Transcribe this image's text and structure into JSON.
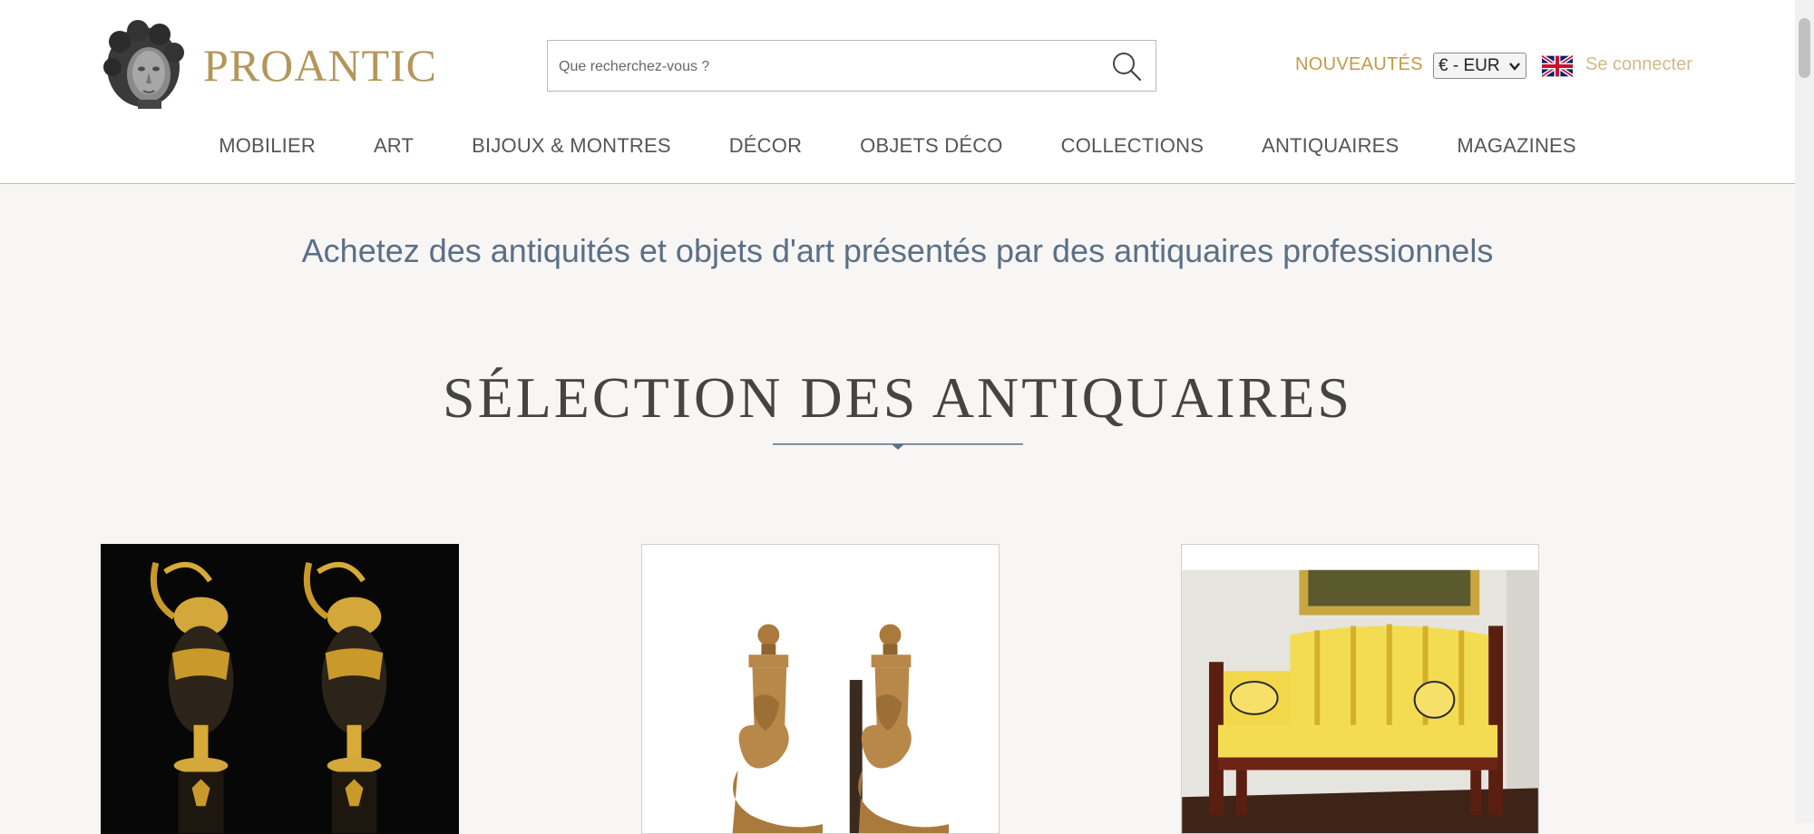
{
  "brand": {
    "name": "PROANTIC",
    "color": "#b5965a"
  },
  "search": {
    "placeholder": "Que recherchez-vous ?",
    "icon": "search-icon"
  },
  "header_links": {
    "new": "NOUVEAUTÉS",
    "currency": "€ - EUR",
    "language_flag": "uk-flag-icon",
    "login": "Se connecter"
  },
  "nav": {
    "items": [
      {
        "label": "MOBILIER"
      },
      {
        "label": "ART"
      },
      {
        "label": "BIJOUX & MONTRES"
      },
      {
        "label": "DÉCOR"
      },
      {
        "label": "OBJETS DÉCO"
      },
      {
        "label": "COLLECTIONS"
      },
      {
        "label": "ANTIQUAIRES"
      },
      {
        "label": "MAGAZINES"
      }
    ]
  },
  "main": {
    "tagline": "Achetez des antiquités et objets d'art présentés par des antiquaires professionnels",
    "section_title": "SÉLECTION DES ANTIQUAIRES"
  },
  "colors": {
    "accent_gold": "#c29a4a",
    "tagline_blue": "#5b6f86",
    "background": "#f7f6f4"
  }
}
